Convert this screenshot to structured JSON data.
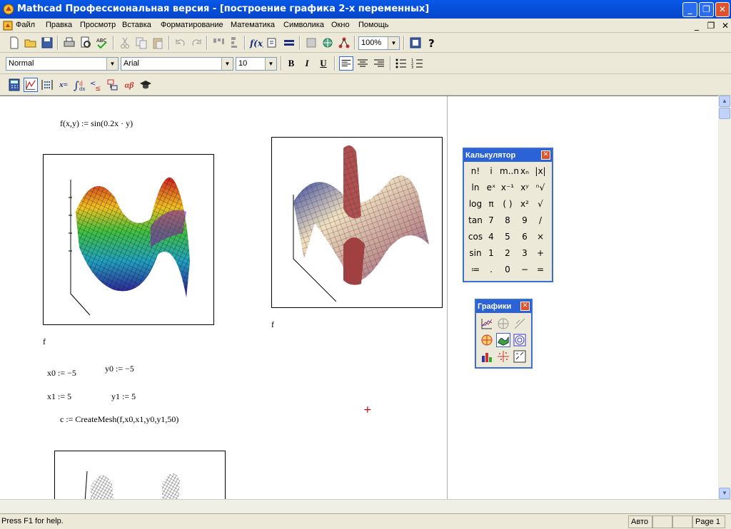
{
  "window": {
    "title": "Mathcad Профессиональная версия - [построение графика 2-х переменных]",
    "minimize": "_",
    "maximize": "❐",
    "close": "✕"
  },
  "menu": {
    "items": [
      "Файл",
      "Правка",
      "Просмотр",
      "Вставка",
      "Форматирование",
      "Математика",
      "Символика",
      "Окно",
      "Помощь"
    ],
    "mdi_minimize": "_",
    "mdi_restore": "❐",
    "mdi_close": "✕"
  },
  "toolbar": {
    "zoom": "100%"
  },
  "format_bar": {
    "style": "Normal",
    "font": "Arial",
    "size": "10",
    "bold": "B",
    "italic": "I",
    "underline": "U"
  },
  "math_bar": {
    "eval_label": "x=",
    "greek_label": "αβ"
  },
  "worksheet": {
    "def_f": "f(x,y) := sin(0.2x · y)",
    "label_f1": "f",
    "label_f2": "f",
    "x0": "x0 := −5",
    "y0": "y0 := −5",
    "x1": "x1 := 5",
    "y1": "y1 := 5",
    "mesh": "c := CreateMesh(f,x0,x1,y0,y1,50)",
    "cursor": "+"
  },
  "calculator": {
    "title": "Калькулятор",
    "close": "✕",
    "keys": [
      [
        "n!",
        "i",
        "m..n",
        "xₙ",
        "|x|"
      ],
      [
        "ln",
        "eˣ",
        "x⁻¹",
        "xʸ",
        "ⁿ√"
      ],
      [
        "log",
        "π",
        "( )",
        "x²",
        "√"
      ],
      [
        "tan",
        "7",
        "8",
        "9",
        "/"
      ],
      [
        "cos",
        "4",
        "5",
        "6",
        "×"
      ],
      [
        "sin",
        "1",
        "2",
        "3",
        "+"
      ],
      [
        "≔",
        ".",
        "0",
        "−",
        "="
      ]
    ]
  },
  "graphs": {
    "title": "Графики",
    "close": "✕"
  },
  "status": {
    "help": "Press F1 for help.",
    "mode": "Авто",
    "page": "Page 1"
  },
  "colors": {
    "titlebar": "#0a59e6",
    "palette_title": "#2b63d6",
    "cursor": "#cc0000"
  }
}
